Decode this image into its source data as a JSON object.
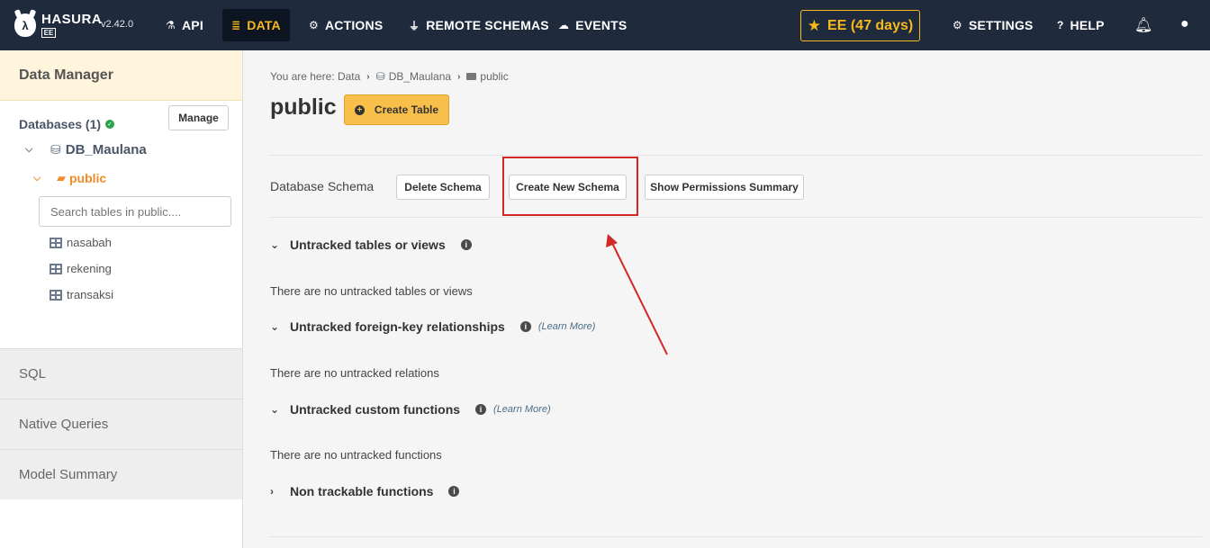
{
  "topbar": {
    "brand": "HASURA",
    "edition": "EE",
    "version": "v2.42.0",
    "nav": [
      {
        "label": "API",
        "icon": "flask-icon"
      },
      {
        "label": "DATA",
        "icon": "database-icon"
      },
      {
        "label": "ACTIONS",
        "icon": "cogs-icon"
      },
      {
        "label": "REMOTE SCHEMAS",
        "icon": "plug-icon"
      },
      {
        "label": "EVENTS",
        "icon": "cloud-icon"
      }
    ],
    "ee_badge": "EE (47 days)",
    "settings": "SETTINGS",
    "help": "HELP",
    "accent_color": "#f8ba1b"
  },
  "sidebar": {
    "header": "Data Manager",
    "databases_label": "Databases (1)",
    "manage_label": "Manage",
    "database_name": "DB_Maulana",
    "schema_name": "public",
    "search_placeholder": "Search tables in public....",
    "tables": [
      "nasabah",
      "rekening",
      "transaksi"
    ],
    "sections": [
      "SQL",
      "Native Queries",
      "Model Summary"
    ]
  },
  "main": {
    "breadcrumb": {
      "prefix": "You are here: Data",
      "database": "DB_Maulana",
      "schema": "public"
    },
    "title": "public",
    "create_table_label": "Create Table",
    "schema_row": {
      "label": "Database Schema",
      "delete_label": "Delete Schema",
      "create_label": "Create New Schema",
      "permissions_label": "Show Permissions Summary"
    },
    "sections": [
      {
        "title": "Untracked tables or views",
        "learn_more": "",
        "empty": "There are no untracked tables or views"
      },
      {
        "title": "Untracked foreign-key relationships",
        "learn_more": "(Learn More)",
        "empty": "There are no untracked relations"
      },
      {
        "title": "Untracked custom functions",
        "learn_more": "(Learn More)",
        "empty": "There are no untracked functions"
      },
      {
        "title": "Non trackable functions",
        "learn_more": "",
        "empty": ""
      }
    ]
  }
}
